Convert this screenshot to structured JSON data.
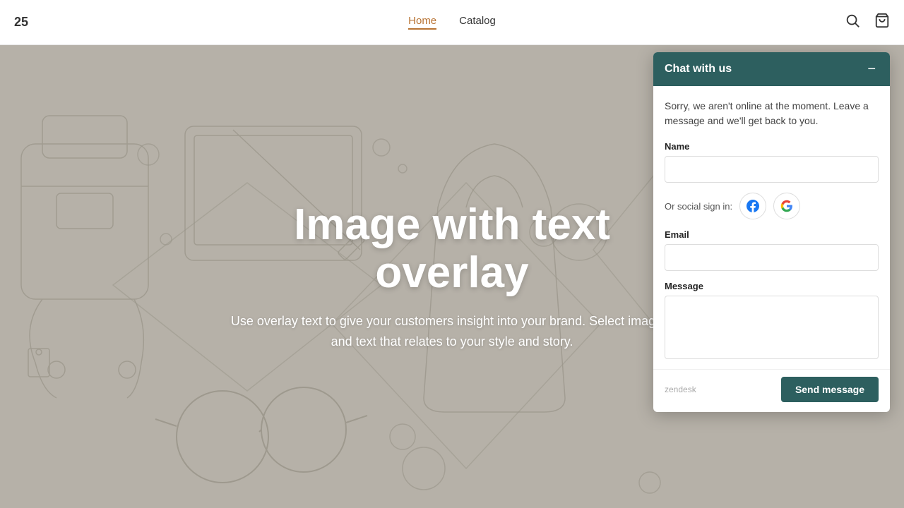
{
  "navbar": {
    "brand": "25",
    "links": [
      {
        "label": "Home",
        "active": true
      },
      {
        "label": "Catalog",
        "active": false
      }
    ],
    "icons": {
      "search": "search-icon",
      "cart": "cart-icon"
    }
  },
  "hero": {
    "title": "Image with text overlay",
    "subtitle": "Use overlay text to give your customers insight into your brand. Select imagery and text that relates to your style and story.",
    "bg_color": "#b5b0a7"
  },
  "chat": {
    "header_title": "Chat with us",
    "minimize_label": "−",
    "offline_message": "Sorry, we aren't online at the moment. Leave a message and we'll get back to you.",
    "name_label": "Name",
    "name_placeholder": "",
    "social_label": "Or social sign in:",
    "email_label": "Email",
    "email_placeholder": "",
    "message_label": "Message",
    "message_placeholder": "",
    "send_button": "Send message",
    "zendesk_label": "zendesk"
  }
}
